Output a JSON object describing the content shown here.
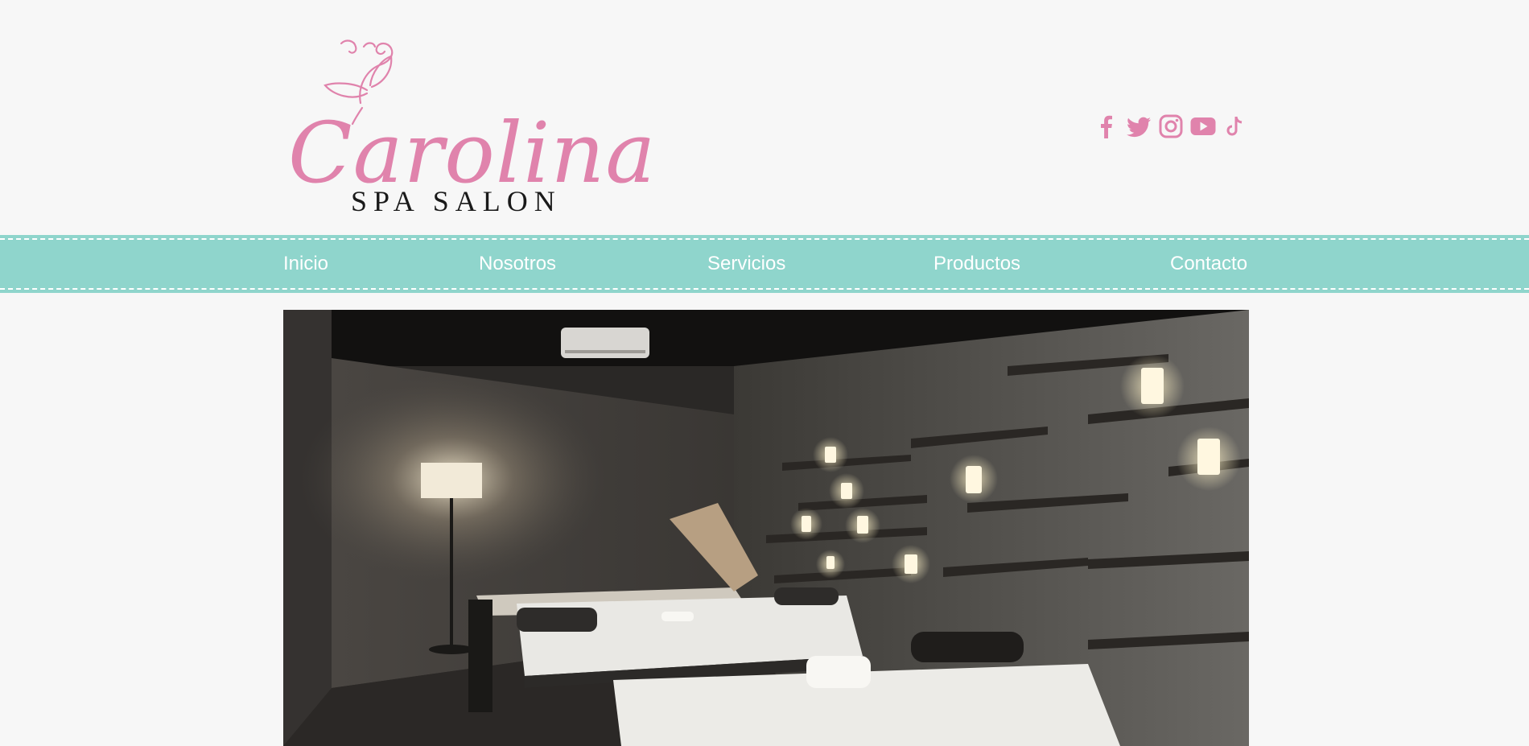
{
  "brand": {
    "name": "Carolina",
    "tagline": "SPA SALON",
    "color": "#e083ac"
  },
  "social": [
    {
      "icon": "facebook-icon"
    },
    {
      "icon": "twitter-icon"
    },
    {
      "icon": "instagram-icon"
    },
    {
      "icon": "youtube-icon"
    },
    {
      "icon": "tiktok-icon"
    }
  ],
  "nav": {
    "background": "#8fd5cc",
    "items": [
      {
        "label": "Inicio"
      },
      {
        "label": "Nosotros"
      },
      {
        "label": "Servicios"
      },
      {
        "label": "Productos"
      },
      {
        "label": "Contacto"
      }
    ]
  },
  "hero": {
    "image": "spa-treatment-room-photo"
  }
}
